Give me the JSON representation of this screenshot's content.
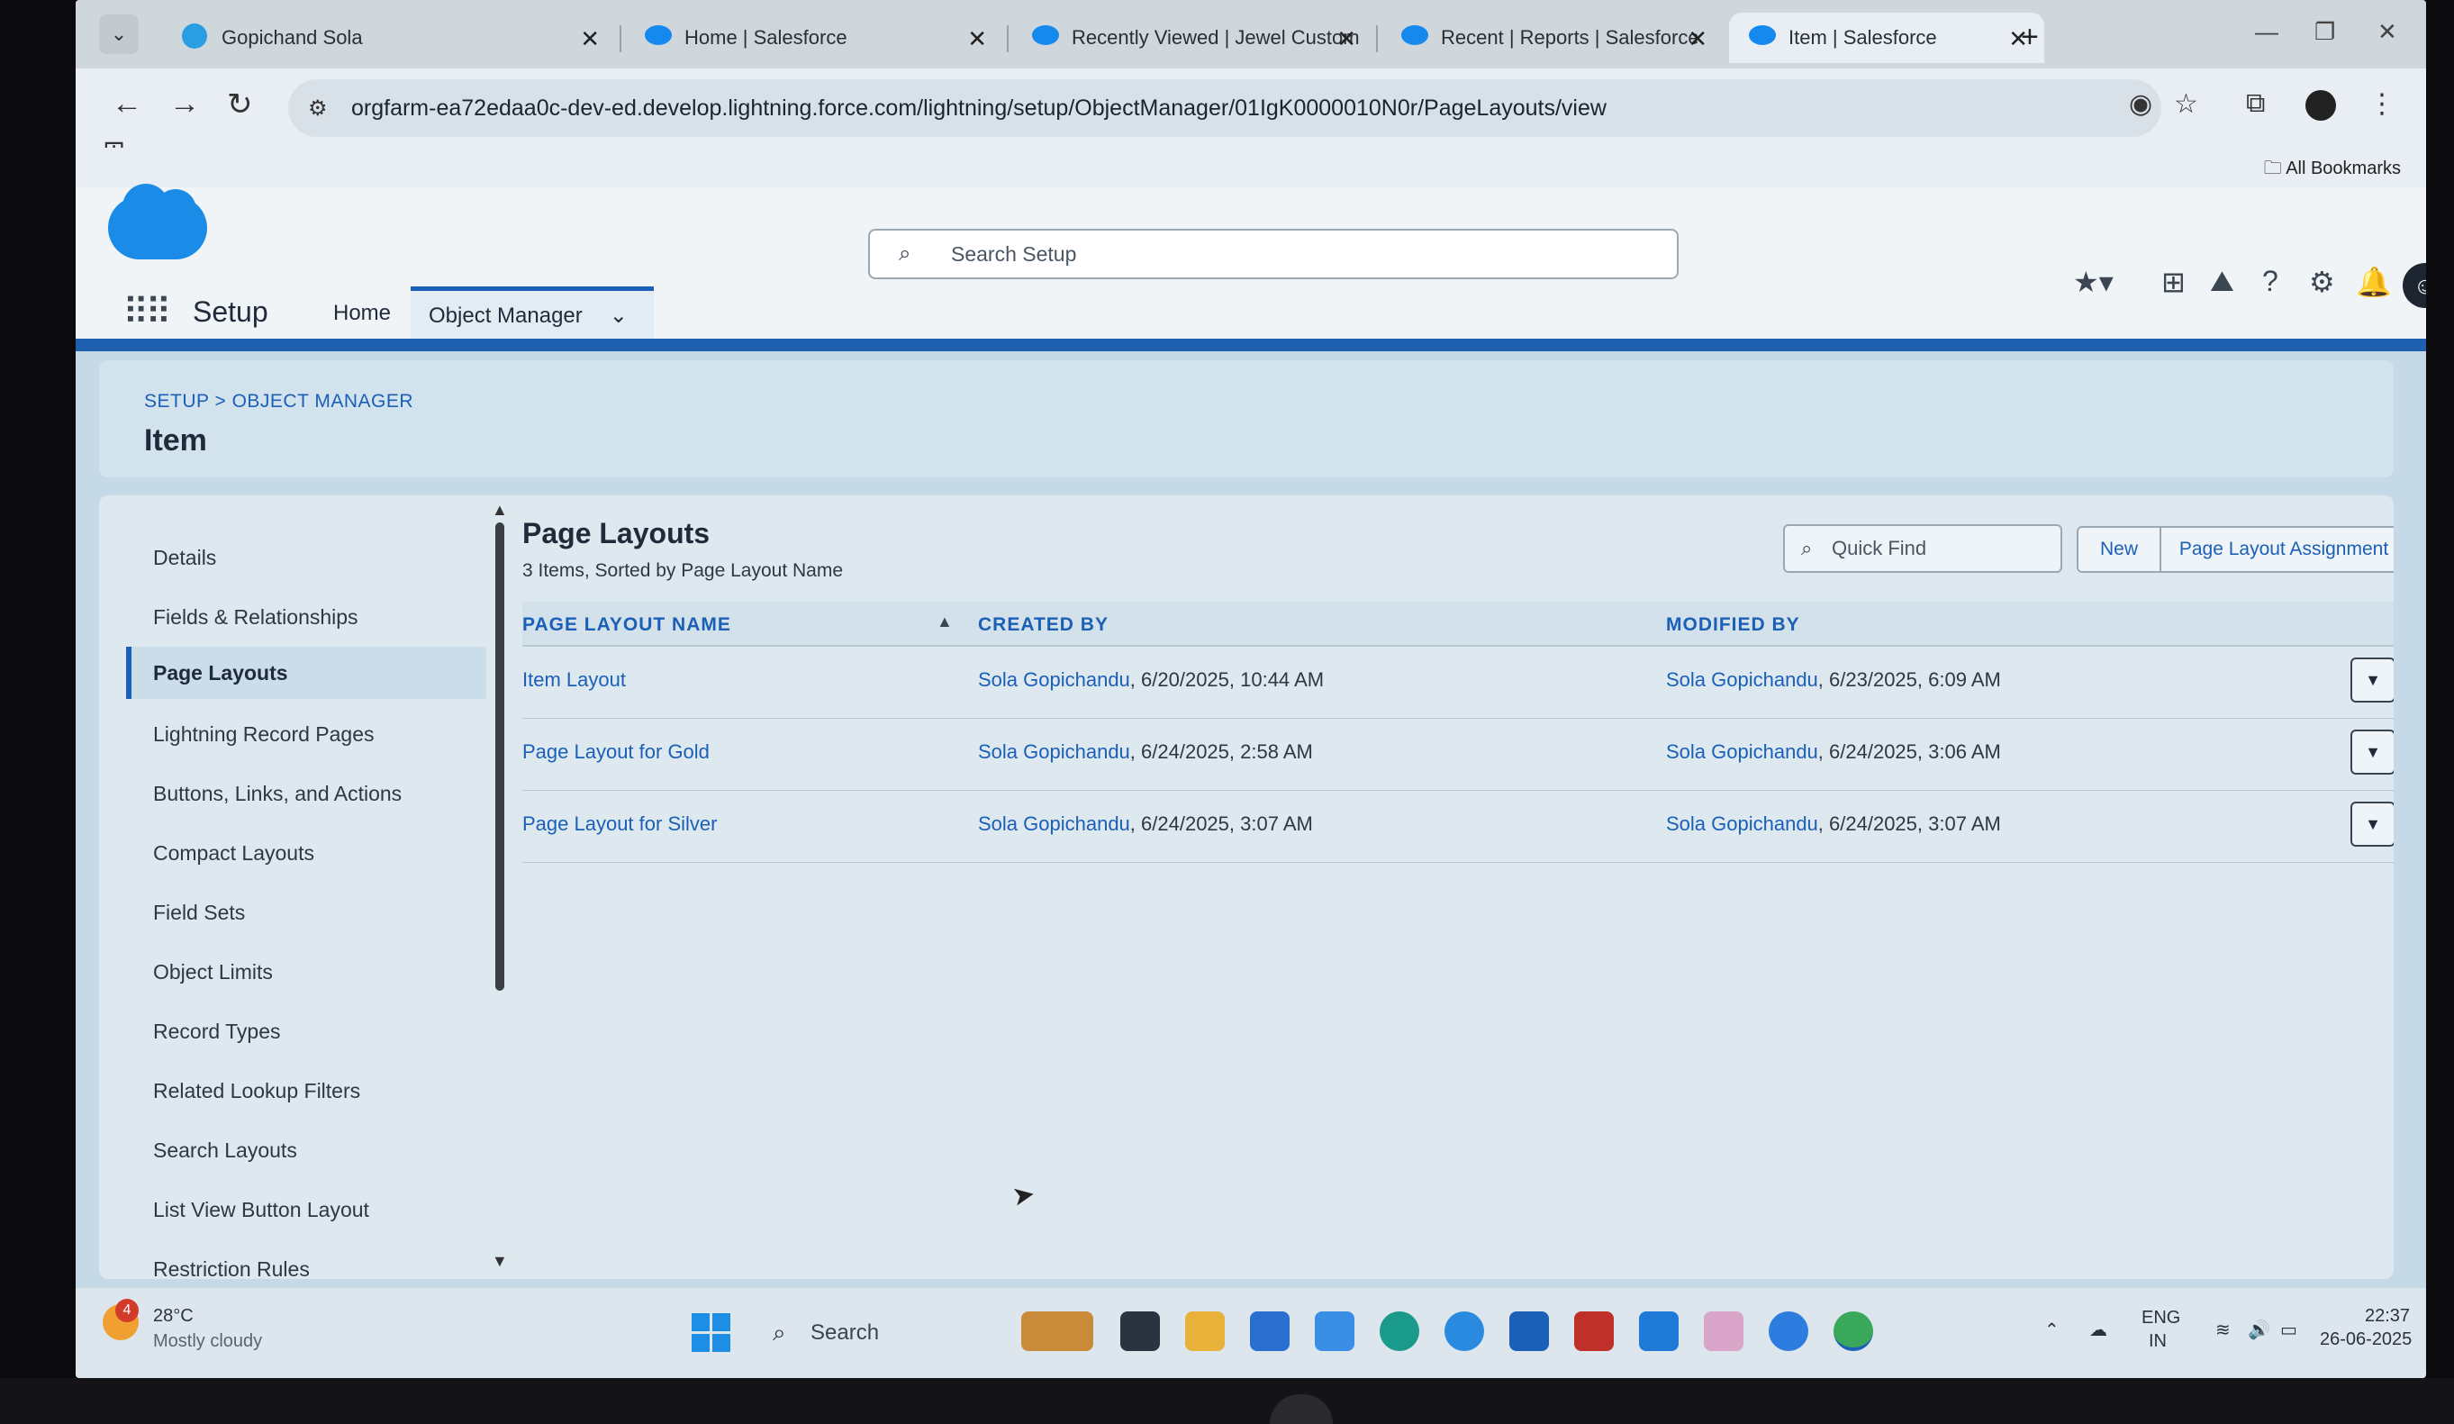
{
  "browser": {
    "tabs": [
      {
        "title": "Gopichand Sola",
        "favicon": "telegram-icon"
      },
      {
        "title": "Home | Salesforce",
        "favicon": "salesforce-cloud-icon"
      },
      {
        "title": "Recently Viewed | Jewel Custom",
        "favicon": "salesforce-cloud-icon"
      },
      {
        "title": "Recent | Reports | Salesforce",
        "favicon": "salesforce-cloud-icon"
      },
      {
        "title": "Item | Salesforce",
        "favicon": "salesforce-cloud-icon",
        "active": true
      }
    ],
    "new_tab": "+",
    "url": "orgfarm-ea72edaa0c-dev-ed.develop.lightning.force.com/lightning/setup/ObjectManager/01IgK0000010N0r/PageLayouts/view",
    "all_bookmarks": "All Bookmarks"
  },
  "header": {
    "search_placeholder": "Search Setup",
    "setup_title": "Setup",
    "nav": {
      "home": "Home",
      "object_manager": "Object Manager"
    }
  },
  "object": {
    "breadcrumb": "SETUP > OBJECT MANAGER",
    "title": "Item"
  },
  "sidebar": {
    "items": [
      "Details",
      "Fields & Relationships",
      "Page Layouts",
      "Lightning Record Pages",
      "Buttons, Links, and Actions",
      "Compact Layouts",
      "Field Sets",
      "Object Limits",
      "Record Types",
      "Related Lookup Filters",
      "Search Layouts",
      "List View Button Layout",
      "Restriction Rules"
    ],
    "active_index": 2
  },
  "page_layouts": {
    "title": "Page Layouts",
    "subtitle": "3 Items, Sorted by Page Layout Name",
    "quick_find_placeholder": "Quick Find",
    "new_button": "New",
    "assignment_button": "Page Layout Assignment",
    "columns": [
      "PAGE LAYOUT NAME",
      "CREATED BY",
      "MODIFIED BY"
    ],
    "rows": [
      {
        "name": "Item Layout",
        "created_by": "Sola Gopichandu",
        "created_on": ", 6/20/2025, 10:44 AM",
        "modified_by": "Sola Gopichandu",
        "modified_on": ", 6/23/2025, 6:09 AM"
      },
      {
        "name": "Page Layout for Gold",
        "created_by": "Sola Gopichandu",
        "created_on": ", 6/24/2025, 2:58 AM",
        "modified_by": "Sola Gopichandu",
        "modified_on": ", 6/24/2025, 3:06 AM"
      },
      {
        "name": "Page Layout for Silver",
        "created_by": "Sola Gopichandu",
        "created_on": ", 6/24/2025, 3:07 AM",
        "modified_by": "Sola Gopichandu",
        "modified_on": ", 6/24/2025, 3:07 AM"
      }
    ]
  },
  "taskbar": {
    "weather_badge": "4",
    "temperature": "28°C",
    "condition": "Mostly cloudy",
    "search_label": "Search",
    "lang_top": "ENG",
    "lang_bottom": "IN",
    "time": "22:37",
    "date": "26-06-2025"
  },
  "colors": {
    "salesforce_blue": "#1b5fb7",
    "brand_cloud": "#1a8ce8",
    "band": "#1f5fb0"
  }
}
